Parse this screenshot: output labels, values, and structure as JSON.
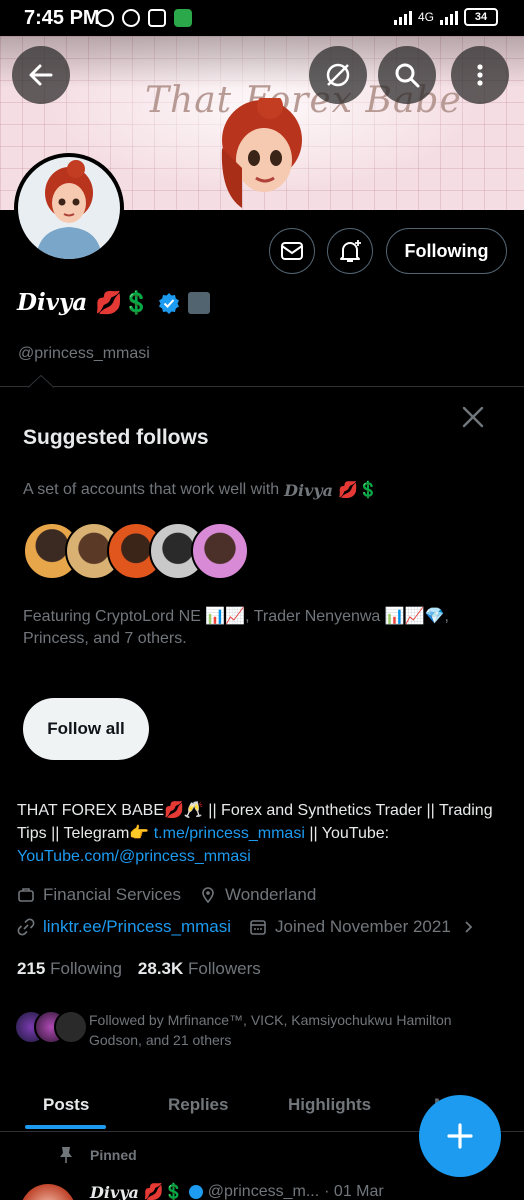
{
  "status_bar": {
    "time": "7:45 PM",
    "network": "4G",
    "battery": "34"
  },
  "banner": {
    "title": "That Forex Babe"
  },
  "header": {
    "back_icon": "arrow-left-icon",
    "grok_icon": "slash-circle-icon",
    "search_icon": "search-icon",
    "more_icon": "vertical-dots-icon"
  },
  "profile": {
    "display_name": "Divya",
    "name_emojis": "💋💲",
    "handle": "@princess_mmasi",
    "following_button": "Following",
    "bio_text": "THAT FOREX BABE💋🥂 || Forex and Synthetics Trader || Trading Tips || Telegram👉 ",
    "bio_link_telegram": "t.me/princess_mmasi",
    "bio_text_2": " || YouTube: ",
    "bio_link_youtube": "YouTube.com/@princess_mmasi",
    "category": "Financial Services",
    "location": "Wonderland",
    "website": "linktr.ee/Princess_mmasi",
    "joined": "Joined November 2021",
    "following_count": "215",
    "following_label": "Following",
    "followers_count": "28.3K",
    "followers_label": "Followers",
    "followed_by": "Followed by Mrfinance™, VICK, Kamsiyochukwu Hamilton Godson, and 21 others"
  },
  "suggested": {
    "title": "Suggested follows",
    "description_prefix": "A set of accounts that work well with",
    "description_name": "Divya",
    "description_emojis": "💋💲",
    "featuring": "Featuring CryptoLord NE 📊📈, Trader Nenyenwa 📊📈💎, Princess, and 7 others.",
    "follow_all": "Follow all"
  },
  "tabs": [
    {
      "label": "Posts",
      "active": true
    },
    {
      "label": "Replies",
      "active": false
    },
    {
      "label": "Highlights",
      "active": false
    },
    {
      "label": "Media",
      "active": false
    }
  ],
  "pinned_label": "Pinned",
  "post": {
    "name": "Divya",
    "emojis": "💋💲",
    "handle": "@princess_m...",
    "date": "· 01 Mar"
  },
  "colors": {
    "accent": "#1d9bf0",
    "background": "#000000",
    "muted": "#71767b"
  }
}
